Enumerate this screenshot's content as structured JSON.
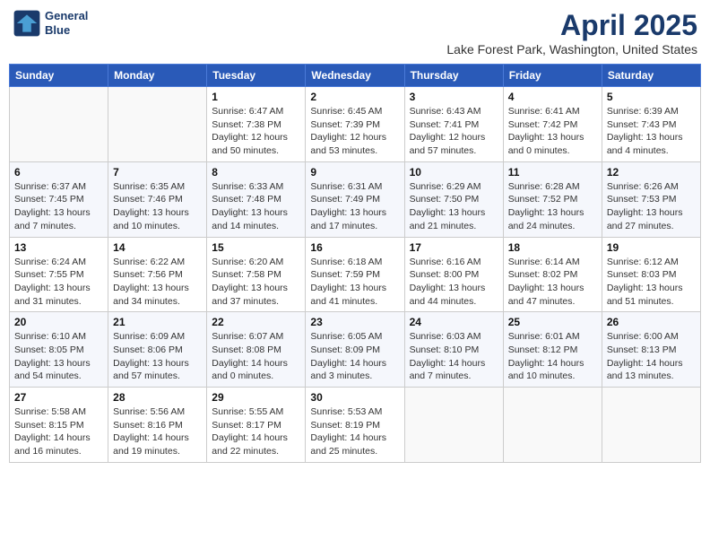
{
  "logo": {
    "line1": "General",
    "line2": "Blue"
  },
  "title": "April 2025",
  "subtitle": "Lake Forest Park, Washington, United States",
  "days_header": [
    "Sunday",
    "Monday",
    "Tuesday",
    "Wednesday",
    "Thursday",
    "Friday",
    "Saturday"
  ],
  "weeks": [
    [
      {
        "num": "",
        "detail": ""
      },
      {
        "num": "",
        "detail": ""
      },
      {
        "num": "1",
        "detail": "Sunrise: 6:47 AM\nSunset: 7:38 PM\nDaylight: 12 hours\nand 50 minutes."
      },
      {
        "num": "2",
        "detail": "Sunrise: 6:45 AM\nSunset: 7:39 PM\nDaylight: 12 hours\nand 53 minutes."
      },
      {
        "num": "3",
        "detail": "Sunrise: 6:43 AM\nSunset: 7:41 PM\nDaylight: 12 hours\nand 57 minutes."
      },
      {
        "num": "4",
        "detail": "Sunrise: 6:41 AM\nSunset: 7:42 PM\nDaylight: 13 hours\nand 0 minutes."
      },
      {
        "num": "5",
        "detail": "Sunrise: 6:39 AM\nSunset: 7:43 PM\nDaylight: 13 hours\nand 4 minutes."
      }
    ],
    [
      {
        "num": "6",
        "detail": "Sunrise: 6:37 AM\nSunset: 7:45 PM\nDaylight: 13 hours\nand 7 minutes."
      },
      {
        "num": "7",
        "detail": "Sunrise: 6:35 AM\nSunset: 7:46 PM\nDaylight: 13 hours\nand 10 minutes."
      },
      {
        "num": "8",
        "detail": "Sunrise: 6:33 AM\nSunset: 7:48 PM\nDaylight: 13 hours\nand 14 minutes."
      },
      {
        "num": "9",
        "detail": "Sunrise: 6:31 AM\nSunset: 7:49 PM\nDaylight: 13 hours\nand 17 minutes."
      },
      {
        "num": "10",
        "detail": "Sunrise: 6:29 AM\nSunset: 7:50 PM\nDaylight: 13 hours\nand 21 minutes."
      },
      {
        "num": "11",
        "detail": "Sunrise: 6:28 AM\nSunset: 7:52 PM\nDaylight: 13 hours\nand 24 minutes."
      },
      {
        "num": "12",
        "detail": "Sunrise: 6:26 AM\nSunset: 7:53 PM\nDaylight: 13 hours\nand 27 minutes."
      }
    ],
    [
      {
        "num": "13",
        "detail": "Sunrise: 6:24 AM\nSunset: 7:55 PM\nDaylight: 13 hours\nand 31 minutes."
      },
      {
        "num": "14",
        "detail": "Sunrise: 6:22 AM\nSunset: 7:56 PM\nDaylight: 13 hours\nand 34 minutes."
      },
      {
        "num": "15",
        "detail": "Sunrise: 6:20 AM\nSunset: 7:58 PM\nDaylight: 13 hours\nand 37 minutes."
      },
      {
        "num": "16",
        "detail": "Sunrise: 6:18 AM\nSunset: 7:59 PM\nDaylight: 13 hours\nand 41 minutes."
      },
      {
        "num": "17",
        "detail": "Sunrise: 6:16 AM\nSunset: 8:00 PM\nDaylight: 13 hours\nand 44 minutes."
      },
      {
        "num": "18",
        "detail": "Sunrise: 6:14 AM\nSunset: 8:02 PM\nDaylight: 13 hours\nand 47 minutes."
      },
      {
        "num": "19",
        "detail": "Sunrise: 6:12 AM\nSunset: 8:03 PM\nDaylight: 13 hours\nand 51 minutes."
      }
    ],
    [
      {
        "num": "20",
        "detail": "Sunrise: 6:10 AM\nSunset: 8:05 PM\nDaylight: 13 hours\nand 54 minutes."
      },
      {
        "num": "21",
        "detail": "Sunrise: 6:09 AM\nSunset: 8:06 PM\nDaylight: 13 hours\nand 57 minutes."
      },
      {
        "num": "22",
        "detail": "Sunrise: 6:07 AM\nSunset: 8:08 PM\nDaylight: 14 hours\nand 0 minutes."
      },
      {
        "num": "23",
        "detail": "Sunrise: 6:05 AM\nSunset: 8:09 PM\nDaylight: 14 hours\nand 3 minutes."
      },
      {
        "num": "24",
        "detail": "Sunrise: 6:03 AM\nSunset: 8:10 PM\nDaylight: 14 hours\nand 7 minutes."
      },
      {
        "num": "25",
        "detail": "Sunrise: 6:01 AM\nSunset: 8:12 PM\nDaylight: 14 hours\nand 10 minutes."
      },
      {
        "num": "26",
        "detail": "Sunrise: 6:00 AM\nSunset: 8:13 PM\nDaylight: 14 hours\nand 13 minutes."
      }
    ],
    [
      {
        "num": "27",
        "detail": "Sunrise: 5:58 AM\nSunset: 8:15 PM\nDaylight: 14 hours\nand 16 minutes."
      },
      {
        "num": "28",
        "detail": "Sunrise: 5:56 AM\nSunset: 8:16 PM\nDaylight: 14 hours\nand 19 minutes."
      },
      {
        "num": "29",
        "detail": "Sunrise: 5:55 AM\nSunset: 8:17 PM\nDaylight: 14 hours\nand 22 minutes."
      },
      {
        "num": "30",
        "detail": "Sunrise: 5:53 AM\nSunset: 8:19 PM\nDaylight: 14 hours\nand 25 minutes."
      },
      {
        "num": "",
        "detail": ""
      },
      {
        "num": "",
        "detail": ""
      },
      {
        "num": "",
        "detail": ""
      }
    ]
  ]
}
